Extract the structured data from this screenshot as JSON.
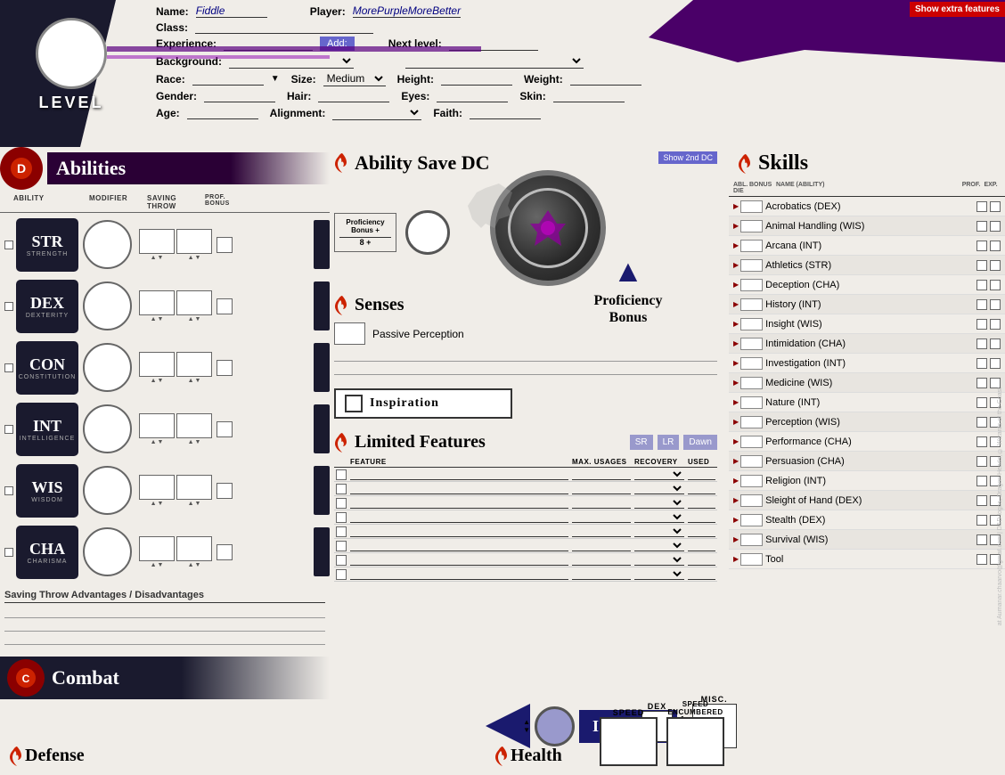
{
  "header": {
    "show_features_label": "Show extra features",
    "name_label": "Name:",
    "name_value": "Fiddle",
    "player_label": "Player:",
    "player_value": "MorePurpleMoreBetter",
    "class_label": "Class:",
    "experience_label": "Experience:",
    "add_btn": "Add:",
    "next_level_label": "Next level:",
    "background_label": "Background:",
    "race_label": "Race:",
    "size_label": "Size:",
    "size_value": "Medium",
    "height_label": "Height:",
    "weight_label": "Weight:",
    "gender_label": "Gender:",
    "hair_label": "Hair:",
    "eyes_label": "Eyes:",
    "skin_label": "Skin:",
    "age_label": "Age:",
    "alignment_label": "Alignment:",
    "faith_label": "Faith:"
  },
  "level": {
    "label": "LEVEL"
  },
  "abilities": {
    "section_title": "Abilities",
    "col_ability": "Ability",
    "col_modifier": "Modifier",
    "col_saving_throw": "Saving Throw",
    "col_prof_bonus": "Prof. Bonus",
    "stats": [
      {
        "abbr": "Str",
        "full": "Strength",
        "id": "str"
      },
      {
        "abbr": "Dex",
        "full": "Dexterity",
        "id": "dex"
      },
      {
        "abbr": "Con",
        "full": "Constitution",
        "id": "con"
      },
      {
        "abbr": "Int",
        "full": "Intelligence",
        "id": "int"
      },
      {
        "abbr": "Wis",
        "full": "Wisdom",
        "id": "wis"
      },
      {
        "abbr": "Cha",
        "full": "Charisma",
        "id": "cha"
      }
    ],
    "saving_throw_adv": "Saving Throw Advantages / Disadvantages"
  },
  "ability_save_dc": {
    "title": "Ability Save DC",
    "show_2nd_dc": "Show 2nd DC",
    "proficiency_bonus_label": "Proficiency\nBonus +",
    "formula": "8 +"
  },
  "senses": {
    "title": "Senses",
    "passive_perception": "Passive Perception"
  },
  "proficiency_bonus": {
    "title": "Proficiency\nBonus"
  },
  "inspiration": {
    "label": "Inspiration"
  },
  "limited_features": {
    "title": "Limited Features",
    "btn_sr": "SR",
    "btn_lr": "LR",
    "btn_dawn": "Dawn",
    "col_feature": "Feature",
    "col_max_usages": "Max. Usages",
    "col_recovery": "Recovery",
    "col_used": "Used",
    "rows": 8
  },
  "skills": {
    "title": "Skills",
    "col_abl": "Abl. Die",
    "col_bonus": "Bonus",
    "col_name": "Name (ability)",
    "col_prof": "Prof.",
    "col_exp": "Exp.",
    "items": [
      {
        "name": "Acrobatics (DEX)",
        "ability": "DEX"
      },
      {
        "name": "Animal Handling (WIS)",
        "ability": "WIS"
      },
      {
        "name": "Arcana (INT)",
        "ability": "INT"
      },
      {
        "name": "Athletics (STR)",
        "ability": "STR"
      },
      {
        "name": "Deception (CHA)",
        "ability": "CHA"
      },
      {
        "name": "History (INT)",
        "ability": "INT"
      },
      {
        "name": "Insight (WIS)",
        "ability": "WIS"
      },
      {
        "name": "Intimidation (CHA)",
        "ability": "CHA"
      },
      {
        "name": "Investigation (INT)",
        "ability": "INT"
      },
      {
        "name": "Medicine (WIS)",
        "ability": "WIS"
      },
      {
        "name": "Nature (INT)",
        "ability": "INT"
      },
      {
        "name": "Perception (WIS)",
        "ability": "WIS"
      },
      {
        "name": "Performance (CHA)",
        "ability": "CHA"
      },
      {
        "name": "Persuasion (CHA)",
        "ability": "CHA"
      },
      {
        "name": "Religion (INT)",
        "ability": "INT"
      },
      {
        "name": "Sleight of Hand (DEX)",
        "ability": "DEX"
      },
      {
        "name": "Stealth (DEX)",
        "ability": "DEX"
      },
      {
        "name": "Survival (WIS)",
        "ability": "WIS"
      },
      {
        "name": "Tool",
        "ability": ""
      }
    ]
  },
  "combat": {
    "section_title": "Combat",
    "defense_title": "Defense",
    "health_title": "Health",
    "initiative_label": "Initiative",
    "dex_label": "Dex",
    "misc_label": "Misc.",
    "speed_label": "Speed",
    "speed_encumbered_label": "Speed\nEncumbered"
  },
  "watermark": "at Aumanar.chaarvo@gmail.com | D&D logos, Dragon Heads, © Wizards of the Coast"
}
